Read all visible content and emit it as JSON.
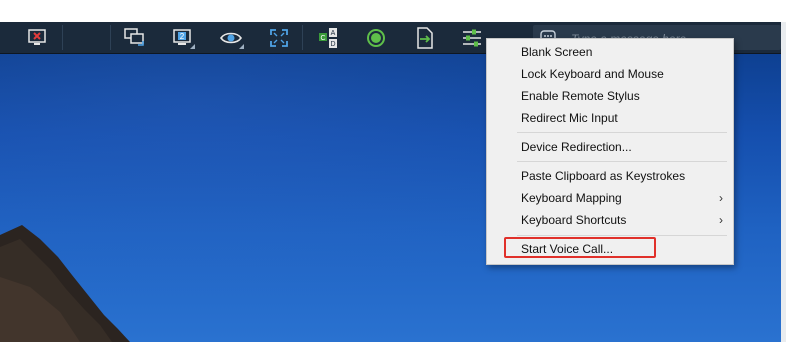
{
  "chat": {
    "placeholder": "Type a message here"
  },
  "toolbar": {
    "icons": [
      "end-session-icon",
      "switch-monitor-icon",
      "monitor-2-icon",
      "view-icon",
      "fullscreen-icon",
      "ctrl-alt-del-icon",
      "record-icon",
      "file-transfer-icon",
      "actions-menu-icon"
    ]
  },
  "menu": {
    "items": [
      {
        "label": "Blank Screen"
      },
      {
        "label": "Lock Keyboard and Mouse"
      },
      {
        "label": "Enable Remote Stylus"
      },
      {
        "label": "Redirect Mic Input"
      },
      {
        "label": "Device Redirection..."
      },
      {
        "label": "Paste Clipboard as Keystrokes"
      },
      {
        "label": "Keyboard Mapping",
        "submenu": "›"
      },
      {
        "label": "Keyboard Shortcuts",
        "submenu": "›"
      },
      {
        "label": "Start Voice Call..."
      }
    ]
  },
  "colors": {
    "toolbar": "#1b2a3b",
    "accent": "#4fa3e6",
    "highlight_box": "#e0302a"
  }
}
